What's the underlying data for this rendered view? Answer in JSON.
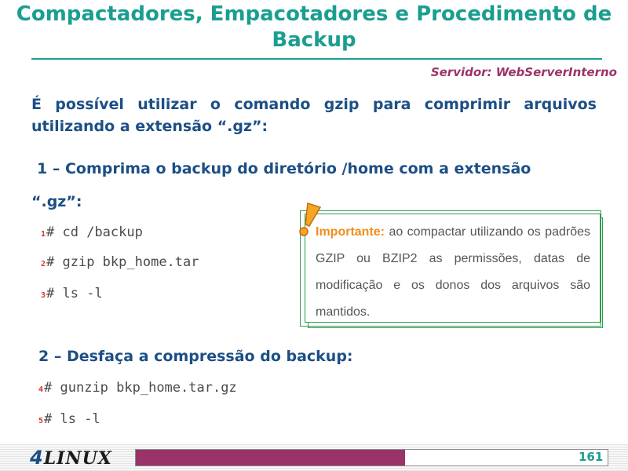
{
  "slide": {
    "title": "Compactadores, Empacotadores e Procedimento de Backup",
    "server_label": "Servidor: WebServerInterno",
    "intro": "É possível utilizar o comando gzip para comprimir arquivos utilizando a extensão “.gz”:",
    "step1_line1": "1 – Comprima o backup do diretório /home com a extensão",
    "step1_line2": "“.gz”:",
    "commands_step1": [
      {
        "num": "1",
        "text": "# cd /backup"
      },
      {
        "num": "2",
        "text": "# gzip bkp_home.tar"
      },
      {
        "num": "3",
        "text": "# ls -l"
      }
    ],
    "step2": "2 – Desfaça a compressão do backup:",
    "commands_step2": [
      {
        "num": "4",
        "text": "# gunzip bkp_home.tar.gz"
      },
      {
        "num": "5",
        "text": "# ls -l"
      }
    ],
    "note": {
      "label": "Importante:",
      "text": "ao compactar utilizando os padrões GZIP ou BZIP2 as permissões, datas de modificação e os donos dos arquivos são mantidos.",
      "icon": "warning-exclamation-icon"
    }
  },
  "footer": {
    "logo_number": "4",
    "logo_text": "LINUX",
    "page_number": "161",
    "progress_fraction": 0.57
  },
  "colors": {
    "title": "#1a9e8f",
    "text": "#1c4f86",
    "server": "#9b3467",
    "note_label": "#f18d1a",
    "note_border": "#2e9c4e",
    "progress": "#9a3367"
  }
}
